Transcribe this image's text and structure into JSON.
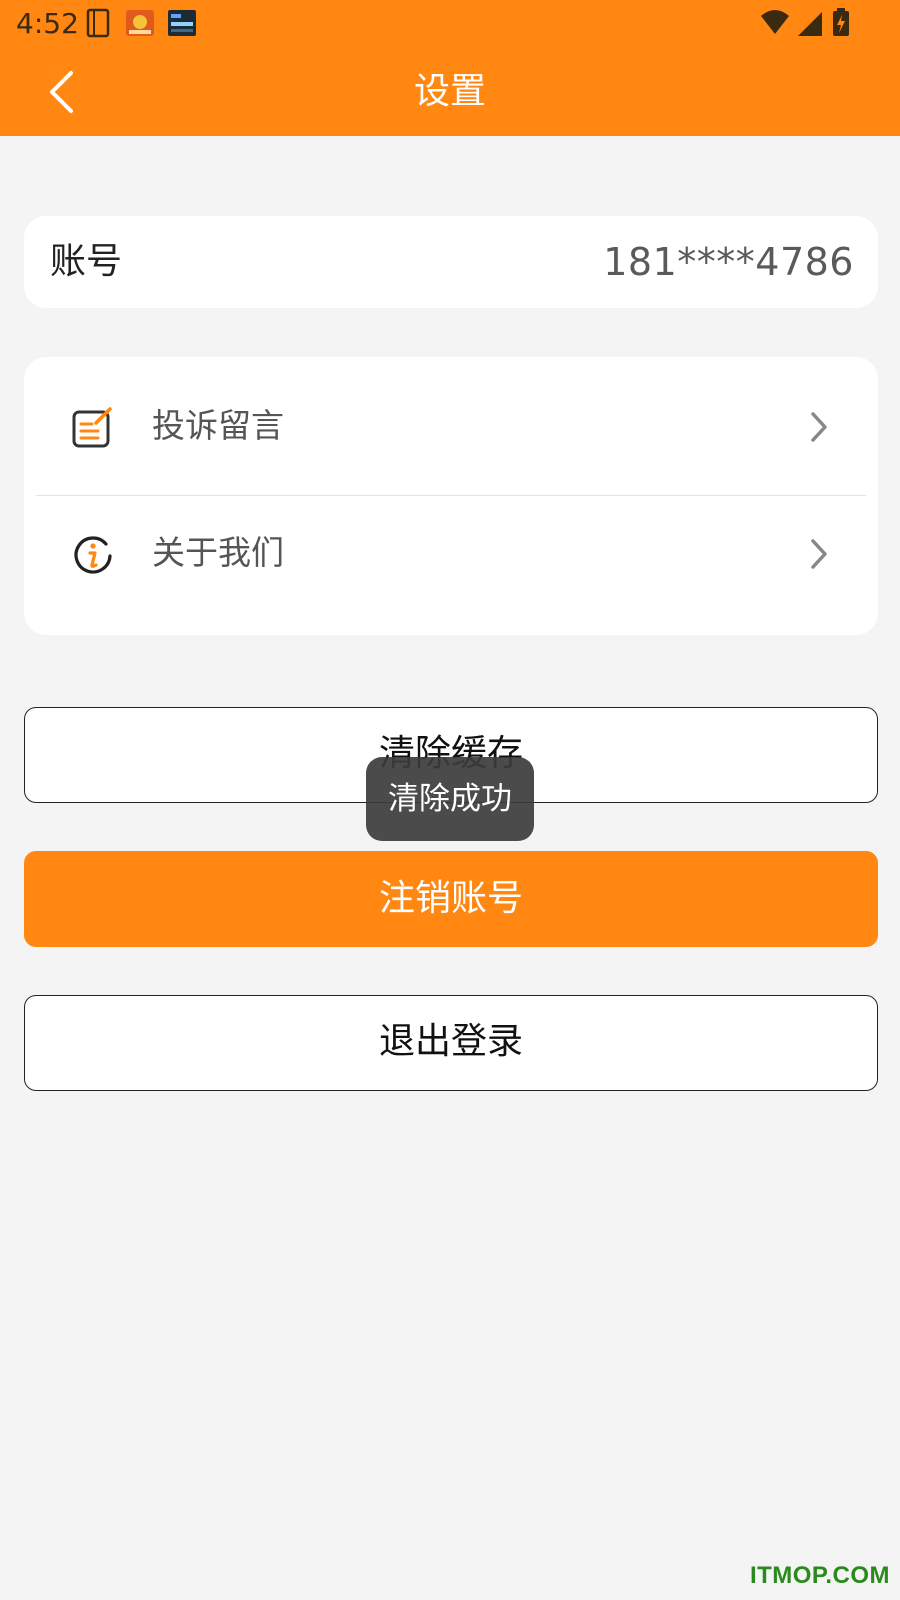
{
  "status_bar": {
    "time": "4:52",
    "notification_icons": [
      "notebook-icon",
      "app-thumbnail-icon",
      "clock-widget-icon"
    ],
    "right_icons": [
      "wifi-icon",
      "cell-signal-icon",
      "battery-charging-icon"
    ]
  },
  "app_bar": {
    "title": "设置",
    "back_icon": "chevron-left-icon"
  },
  "account": {
    "label": "账号",
    "value": "181****4786"
  },
  "menu": {
    "items": [
      {
        "label": "投诉留言",
        "icon": "edit-note-icon"
      },
      {
        "label": "关于我们",
        "icon": "info-circle-icon"
      }
    ]
  },
  "buttons": {
    "clear_cache": "清除缓存",
    "cancel_account": "注销账号",
    "logout": "退出登录"
  },
  "toast": {
    "message": "清除成功"
  },
  "watermark": "ITMOP.COM",
  "colors": {
    "accent": "#ff8712",
    "background": "#f4f4f4",
    "card": "#ffffff",
    "toast_bg": "#3c3c3c",
    "watermark": "#2b8a1e"
  }
}
